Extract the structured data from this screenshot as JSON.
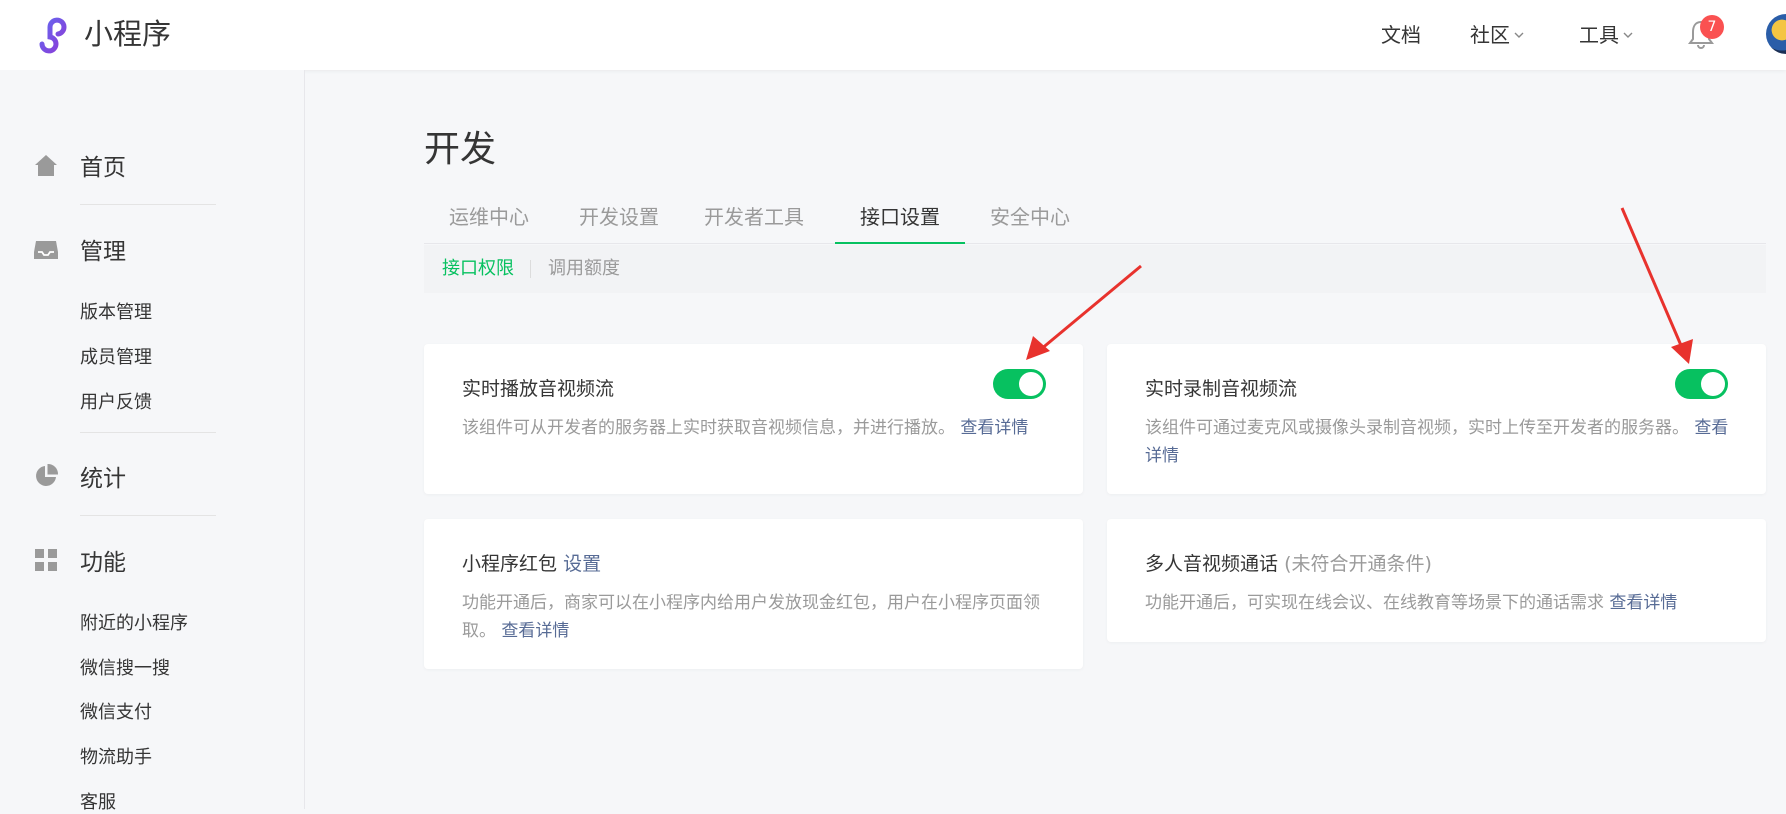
{
  "header": {
    "app_title": "小程序",
    "nav": [
      {
        "label": "文档"
      },
      {
        "label": "社区"
      },
      {
        "label": "工具"
      }
    ],
    "notification_count": "7"
  },
  "sidebar": {
    "groups": [
      {
        "label": "首页",
        "icon": "home-icon"
      },
      {
        "label": "管理",
        "icon": "inbox-icon",
        "items": [
          "版本管理",
          "成员管理",
          "用户反馈"
        ]
      },
      {
        "label": "统计",
        "icon": "pie-chart-icon"
      },
      {
        "label": "功能",
        "icon": "grid-icon",
        "items": [
          "附近的小程序",
          "微信搜一搜",
          "微信支付",
          "物流助手",
          "客服"
        ]
      }
    ]
  },
  "main": {
    "title": "开发",
    "tabs": [
      "运维中心",
      "开发设置",
      "开发者工具",
      "接口设置",
      "安全中心"
    ],
    "active_tab": "接口设置",
    "subtabs": [
      "接口权限",
      "调用额度"
    ],
    "cards": [
      {
        "title": "实时播放音视频流",
        "desc": "该组件可从开发者的服务器上实时获取音视频信息，并进行播放。",
        "link": "查看详情",
        "enabled": true
      },
      {
        "title": "实时录制音视频流",
        "desc": "该组件可通过麦克风或摄像头录制音视频，实时上传至开发者的服务器。",
        "link": "查看详情",
        "enabled": true
      },
      {
        "title": "小程序红包",
        "title_link": "设置",
        "desc": "功能开通后，商家可以在小程序内给用户发放现金红包，用户在小程序页面领取。",
        "link": "查看详情"
      },
      {
        "title": "多人音视频通话",
        "title_note": "(未符合开通条件)",
        "desc": "功能开通后，可实现在线会议、在线教育等场景下的通话需求",
        "link": "查看详情"
      }
    ]
  },
  "colors": {
    "accent_green": "#07c160",
    "link_blue": "#576b95",
    "badge_red": "#fa5151",
    "annotation_red": "#e8322d"
  }
}
